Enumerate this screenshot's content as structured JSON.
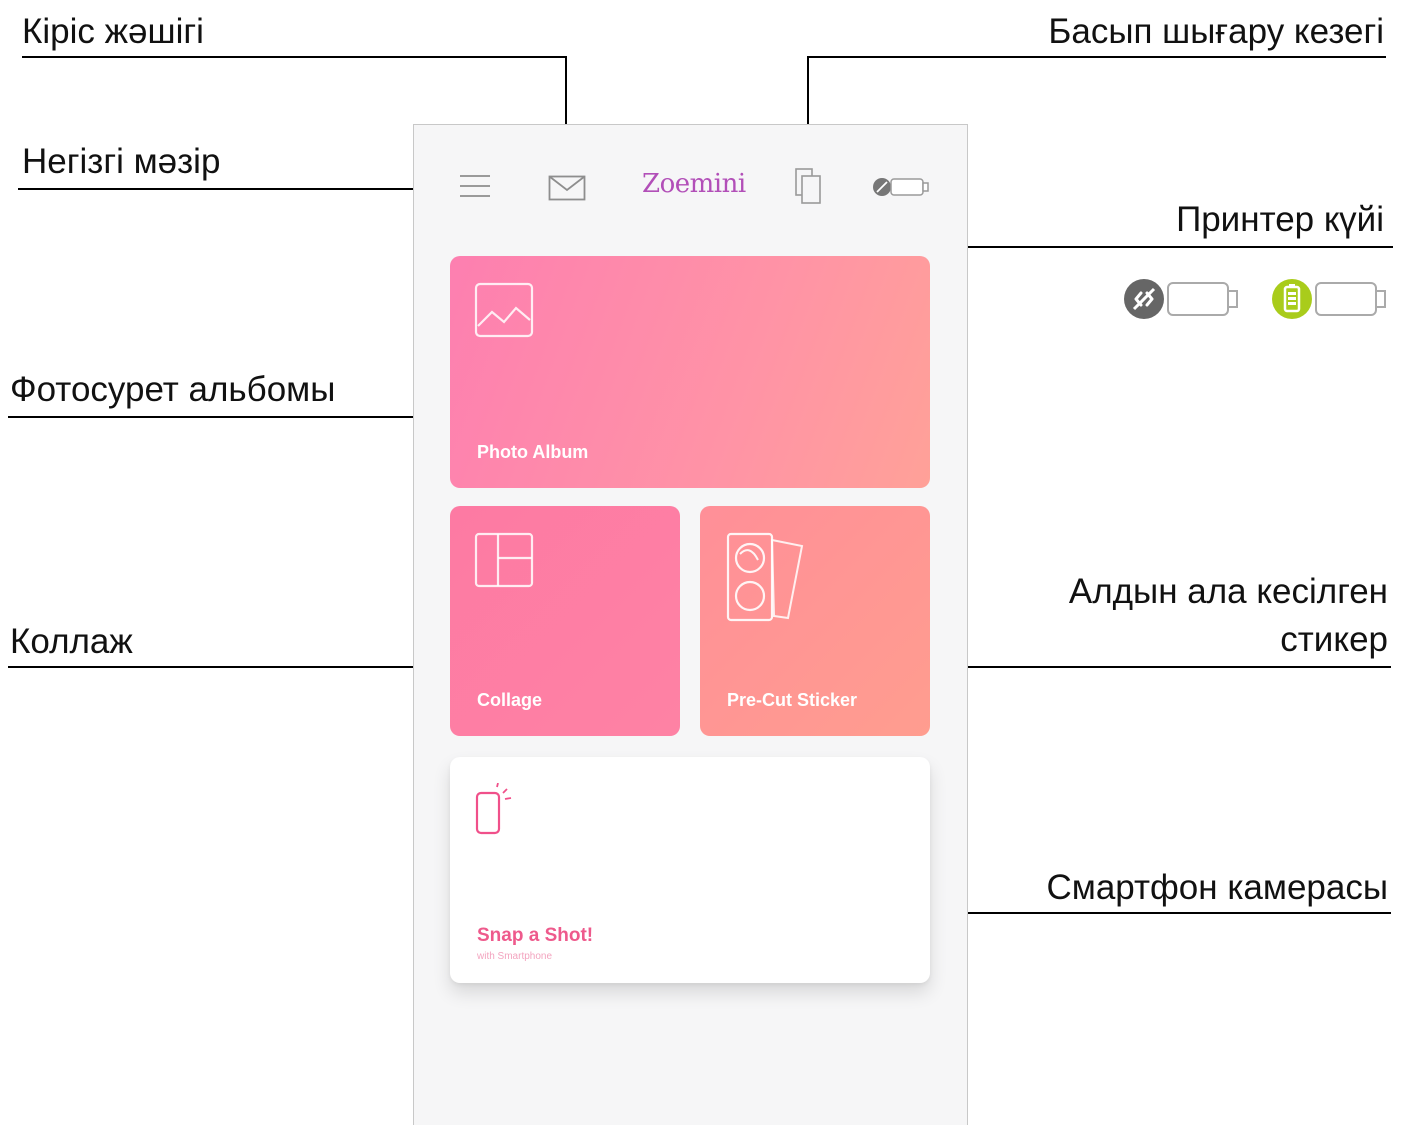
{
  "callouts": {
    "inbox": "Кіріс жәшігі",
    "print_queue": "Басып шығару кезегі",
    "main_menu": "Негізгі мәзір",
    "printer_status": "Принтер күйі",
    "photo_album": "Фотосурет альбомы",
    "precut_line1": "Алдын ала кесілген",
    "precut_line2": "стикер",
    "collage": "Коллаж",
    "smartphone_camera": "Смартфон камерасы"
  },
  "app": {
    "title": "Zoemini",
    "icons": [
      "menu-icon",
      "mail-icon",
      "print-queue-icon",
      "printer-status-icon"
    ]
  },
  "cards": {
    "photo_album": "Photo Album",
    "collage": "Collage",
    "precut_sticker": "Pre-Cut Sticker",
    "snap_title": "Snap a Shot!",
    "snap_subtitle": "with Smartphone"
  },
  "colors": {
    "accent_title": "#b24fb8",
    "card_pink": "#fd80a8",
    "card_coral": "#ff9d8f",
    "snap_text": "#ee5a8c",
    "status_disconnected": "#666666",
    "status_battery": "#a9cc1b"
  },
  "status_icons": [
    "disconnected-status-icon",
    "battery-status-icon"
  ]
}
